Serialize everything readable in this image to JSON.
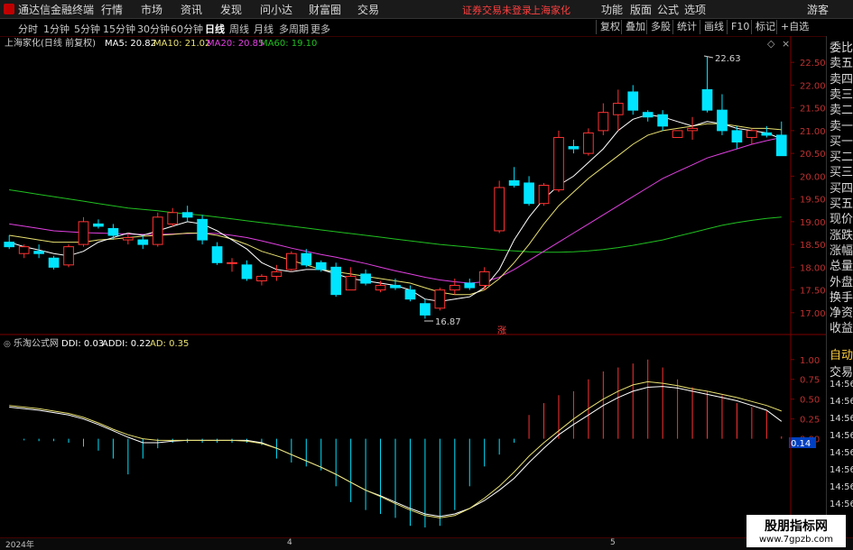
{
  "menubar": {
    "app_title": "通达信金融终端",
    "items": [
      "行情",
      "市场",
      "资讯",
      "发现",
      "问小达",
      "财富圈",
      "交易"
    ],
    "alert_text": "证券交易未登录",
    "alert_stock": "上海家化",
    "right_items": [
      "功能",
      "版面",
      "公式",
      "选项"
    ],
    "far_right": "游客"
  },
  "toolbar": {
    "periods": [
      "分时",
      "1分钟",
      "5分钟",
      "15分钟",
      "30分钟",
      "60分钟",
      "日线",
      "周线",
      "月线",
      "多周期",
      "更多"
    ],
    "selected": "日线",
    "right_buttons": [
      "复权",
      "叠加",
      "多股",
      "统计",
      "画线",
      "F10",
      "标记",
      "+自选"
    ]
  },
  "main_chart": {
    "header": "上海家化(日线 前复权)",
    "ma5_label": "MA5: 20.82",
    "ma10_label": "MA10: 21.02",
    "ma20_label": "MA20: 20.85",
    "ma60_label": "MA60: 19.10",
    "high_marker": "22.63",
    "low_marker": "16.87",
    "zhang_marker": "涨"
  },
  "indicator": {
    "header": "乐淘公式网",
    "ddi_label": "DDI: 0.03",
    "addi_label": "ADDI: 0.22",
    "ad_label": "AD: 0.35",
    "current_value": "0.14"
  },
  "colors": {
    "up": "#ff3232",
    "down": "#00e4ff",
    "ma5": "#ffffff",
    "ma10": "#e8e070",
    "ma20": "#e040e0",
    "ma60": "#20c020"
  },
  "right_panel": {
    "items": [
      "委比",
      "卖五",
      "卖四",
      "卖三",
      "卖二",
      "卖一",
      "买一",
      "买二",
      "买三",
      "买四",
      "买五",
      "现价",
      "涨跌",
      "涨幅",
      "总量",
      "外盘",
      "换手",
      "净资",
      "收益"
    ],
    "lower_items": [
      "自动",
      "交易",
      "14:56",
      "14:56",
      "14:56",
      "14:56",
      "14:56",
      "14:56",
      "14:56",
      "14:56"
    ]
  },
  "bottom": {
    "date_labels": [
      "2024年",
      "4",
      "5"
    ]
  },
  "watermark": {
    "line1": "股朋指标网",
    "line2": "www.7gpzb.com"
  },
  "chart_data": [
    {
      "type": "candlestick",
      "title": "上海家化(日线 前复权)",
      "ylim": [
        16.7,
        22.8
      ],
      "y_ticks": [
        17.0,
        17.5,
        18.0,
        18.5,
        19.0,
        19.5,
        20.0,
        20.5,
        21.0,
        21.5,
        22.0,
        22.5
      ],
      "candles": [
        {
          "o": 18.55,
          "h": 18.7,
          "l": 18.4,
          "c": 18.45
        },
        {
          "o": 18.3,
          "h": 18.5,
          "l": 18.2,
          "c": 18.45
        },
        {
          "o": 18.35,
          "h": 18.5,
          "l": 18.2,
          "c": 18.3
        },
        {
          "o": 18.2,
          "h": 18.25,
          "l": 17.95,
          "c": 18.0
        },
        {
          "o": 18.05,
          "h": 18.5,
          "l": 18.0,
          "c": 18.45
        },
        {
          "o": 18.5,
          "h": 19.1,
          "l": 18.45,
          "c": 19.0
        },
        {
          "o": 18.95,
          "h": 19.05,
          "l": 18.85,
          "c": 18.9
        },
        {
          "o": 18.85,
          "h": 18.95,
          "l": 18.6,
          "c": 18.7
        },
        {
          "o": 18.6,
          "h": 18.75,
          "l": 18.5,
          "c": 18.65
        },
        {
          "o": 18.6,
          "h": 18.7,
          "l": 18.4,
          "c": 18.5
        },
        {
          "o": 18.5,
          "h": 19.2,
          "l": 18.45,
          "c": 19.1
        },
        {
          "o": 18.95,
          "h": 19.3,
          "l": 18.9,
          "c": 19.2
        },
        {
          "o": 19.2,
          "h": 19.35,
          "l": 19.0,
          "c": 19.1
        },
        {
          "o": 19.05,
          "h": 19.15,
          "l": 18.5,
          "c": 18.6
        },
        {
          "o": 18.45,
          "h": 18.55,
          "l": 18.05,
          "c": 18.1
        },
        {
          "o": 18.1,
          "h": 18.2,
          "l": 17.9,
          "c": 18.1
        },
        {
          "o": 18.05,
          "h": 18.15,
          "l": 17.7,
          "c": 17.75
        },
        {
          "o": 17.7,
          "h": 17.85,
          "l": 17.6,
          "c": 17.8
        },
        {
          "o": 17.8,
          "h": 18.05,
          "l": 17.7,
          "c": 17.9
        },
        {
          "o": 17.95,
          "h": 18.35,
          "l": 17.9,
          "c": 18.3
        },
        {
          "o": 18.3,
          "h": 18.4,
          "l": 18.0,
          "c": 18.05
        },
        {
          "o": 18.1,
          "h": 18.15,
          "l": 17.9,
          "c": 17.95
        },
        {
          "o": 18.0,
          "h": 18.1,
          "l": 17.35,
          "c": 17.4
        },
        {
          "o": 17.5,
          "h": 18.0,
          "l": 17.5,
          "c": 17.8
        },
        {
          "o": 17.85,
          "h": 17.95,
          "l": 17.6,
          "c": 17.65
        },
        {
          "o": 17.5,
          "h": 17.7,
          "l": 17.45,
          "c": 17.6
        },
        {
          "o": 17.6,
          "h": 17.75,
          "l": 17.5,
          "c": 17.55
        },
        {
          "o": 17.5,
          "h": 17.6,
          "l": 17.25,
          "c": 17.3
        },
        {
          "o": 17.2,
          "h": 17.3,
          "l": 16.87,
          "c": 16.95
        },
        {
          "o": 17.1,
          "h": 17.55,
          "l": 17.05,
          "c": 17.5
        },
        {
          "o": 17.5,
          "h": 17.75,
          "l": 17.4,
          "c": 17.6
        },
        {
          "o": 17.65,
          "h": 17.75,
          "l": 17.5,
          "c": 17.55
        },
        {
          "o": 17.6,
          "h": 18.0,
          "l": 17.5,
          "c": 17.9
        },
        {
          "o": 18.8,
          "h": 19.9,
          "l": 18.75,
          "c": 19.75
        },
        {
          "o": 19.9,
          "h": 20.2,
          "l": 19.75,
          "c": 19.8
        },
        {
          "o": 19.85,
          "h": 20.0,
          "l": 19.35,
          "c": 19.4
        },
        {
          "o": 19.4,
          "h": 19.85,
          "l": 19.35,
          "c": 19.8
        },
        {
          "o": 19.7,
          "h": 21.0,
          "l": 19.65,
          "c": 20.85
        },
        {
          "o": 20.65,
          "h": 20.8,
          "l": 20.5,
          "c": 20.6
        },
        {
          "o": 20.5,
          "h": 21.05,
          "l": 20.45,
          "c": 20.95
        },
        {
          "o": 21.0,
          "h": 21.6,
          "l": 20.9,
          "c": 21.4
        },
        {
          "o": 21.35,
          "h": 21.9,
          "l": 21.0,
          "c": 21.6
        },
        {
          "o": 21.85,
          "h": 22.0,
          "l": 21.35,
          "c": 21.45
        },
        {
          "o": 21.4,
          "h": 21.45,
          "l": 21.2,
          "c": 21.3
        },
        {
          "o": 21.35,
          "h": 21.45,
          "l": 21.0,
          "c": 21.1
        },
        {
          "o": 20.85,
          "h": 21.0,
          "l": 20.85,
          "c": 21.0
        },
        {
          "o": 21.0,
          "h": 21.3,
          "l": 20.8,
          "c": 21.05
        },
        {
          "o": 21.9,
          "h": 22.63,
          "l": 21.4,
          "c": 21.45
        },
        {
          "o": 21.45,
          "h": 21.8,
          "l": 20.9,
          "c": 21.0
        },
        {
          "o": 21.0,
          "h": 21.1,
          "l": 20.6,
          "c": 20.75
        },
        {
          "o": 20.85,
          "h": 21.05,
          "l": 20.7,
          "c": 21.0
        },
        {
          "o": 20.95,
          "h": 21.1,
          "l": 20.85,
          "c": 20.9
        },
        {
          "o": 20.9,
          "h": 21.2,
          "l": 20.45,
          "c": 20.45
        }
      ],
      "ma5": [
        18.55,
        18.45,
        18.38,
        18.3,
        18.25,
        18.35,
        18.55,
        18.65,
        18.75,
        18.7,
        18.8,
        18.9,
        19.0,
        18.95,
        18.8,
        18.6,
        18.4,
        18.1,
        17.95,
        17.9,
        17.95,
        17.95,
        17.85,
        17.75,
        17.7,
        17.65,
        17.6,
        17.5,
        17.3,
        17.25,
        17.3,
        17.35,
        17.55,
        17.95,
        18.6,
        19.1,
        19.5,
        19.8,
        20.0,
        20.3,
        20.6,
        21.0,
        21.25,
        21.35,
        21.3,
        21.2,
        21.1,
        21.2,
        21.15,
        21.05,
        21.0,
        20.95,
        20.82
      ],
      "ma10": [
        18.7,
        18.65,
        18.6,
        18.55,
        18.55,
        18.55,
        18.6,
        18.62,
        18.65,
        18.68,
        18.7,
        18.72,
        18.75,
        18.75,
        18.7,
        18.62,
        18.5,
        18.35,
        18.25,
        18.15,
        18.05,
        17.95,
        17.9,
        17.85,
        17.8,
        17.75,
        17.7,
        17.65,
        17.55,
        17.45,
        17.4,
        17.4,
        17.5,
        17.75,
        18.1,
        18.5,
        18.95,
        19.35,
        19.65,
        19.95,
        20.2,
        20.45,
        20.7,
        20.9,
        21.0,
        21.05,
        21.1,
        21.15,
        21.15,
        21.1,
        21.05,
        21.05,
        21.02
      ],
      "ma20": [
        18.95,
        18.9,
        18.85,
        18.8,
        18.78,
        18.76,
        18.75,
        18.74,
        18.73,
        18.72,
        18.72,
        18.73,
        18.74,
        18.75,
        18.74,
        18.7,
        18.65,
        18.58,
        18.5,
        18.42,
        18.35,
        18.28,
        18.22,
        18.15,
        18.08,
        18.0,
        17.92,
        17.85,
        17.78,
        17.72,
        17.68,
        17.65,
        17.68,
        17.78,
        17.95,
        18.15,
        18.35,
        18.55,
        18.75,
        18.95,
        19.15,
        19.35,
        19.55,
        19.75,
        19.95,
        20.1,
        20.25,
        20.4,
        20.5,
        20.6,
        20.7,
        20.78,
        20.85
      ],
      "ma60": [
        19.7,
        19.65,
        19.6,
        19.55,
        19.5,
        19.45,
        19.4,
        19.35,
        19.3,
        19.27,
        19.24,
        19.2,
        19.17,
        19.14,
        19.1,
        19.06,
        19.02,
        18.98,
        18.94,
        18.9,
        18.86,
        18.82,
        18.78,
        18.74,
        18.7,
        18.66,
        18.62,
        18.58,
        18.54,
        18.5,
        18.47,
        18.44,
        18.41,
        18.38,
        18.36,
        18.34,
        18.33,
        18.33,
        18.34,
        18.36,
        18.39,
        18.43,
        18.48,
        18.54,
        18.6,
        18.68,
        18.76,
        18.84,
        18.92,
        18.98,
        19.03,
        19.07,
        19.1
      ]
    },
    {
      "type": "bar",
      "title": "乐淘公式网",
      "ylim": [
        -1.2,
        1.1
      ],
      "y_ticks": [
        0.0,
        0.25,
        0.5,
        0.75,
        1.0
      ],
      "series": [
        {
          "name": "DDI",
          "values": [
            0.0,
            -0.02,
            -0.03,
            -0.03,
            -0.05,
            -0.1,
            -0.15,
            -0.25,
            -0.45,
            -0.25,
            -0.12,
            -0.05,
            -0.05,
            -0.05,
            -0.05,
            -0.05,
            -0.05,
            -0.08,
            -0.25,
            -0.3,
            -0.35,
            -0.4,
            -0.6,
            -0.8,
            -0.9,
            -0.95,
            -1.0,
            -1.1,
            -1.12,
            -1.1,
            -0.9,
            -0.6,
            -0.35,
            -0.2,
            -0.05,
            0.3,
            0.45,
            0.55,
            0.6,
            0.75,
            0.85,
            0.9,
            0.95,
            1.0,
            0.9,
            0.75,
            0.65,
            0.6,
            0.55,
            0.45,
            0.4,
            0.35,
            0.03
          ]
        },
        {
          "name": "ADDI",
          "values": [
            0.4,
            0.38,
            0.36,
            0.33,
            0.3,
            0.25,
            0.18,
            0.1,
            0.02,
            -0.05,
            -0.05,
            -0.03,
            -0.02,
            -0.02,
            -0.02,
            -0.02,
            -0.02,
            -0.05,
            -0.12,
            -0.2,
            -0.28,
            -0.36,
            -0.45,
            -0.55,
            -0.65,
            -0.72,
            -0.8,
            -0.88,
            -0.95,
            -0.98,
            -0.95,
            -0.88,
            -0.78,
            -0.65,
            -0.5,
            -0.3,
            -0.12,
            0.05,
            0.18,
            0.3,
            0.42,
            0.52,
            0.6,
            0.65,
            0.66,
            0.64,
            0.6,
            0.56,
            0.52,
            0.48,
            0.42,
            0.36,
            0.22
          ]
        },
        {
          "name": "AD",
          "values": [
            0.42,
            0.4,
            0.38,
            0.35,
            0.32,
            0.27,
            0.2,
            0.12,
            0.05,
            0.0,
            -0.02,
            -0.02,
            -0.02,
            -0.02,
            -0.02,
            -0.02,
            -0.03,
            -0.06,
            -0.12,
            -0.2,
            -0.28,
            -0.36,
            -0.45,
            -0.55,
            -0.65,
            -0.73,
            -0.82,
            -0.9,
            -0.97,
            -1.0,
            -0.97,
            -0.88,
            -0.75,
            -0.6,
            -0.42,
            -0.22,
            -0.05,
            0.1,
            0.25,
            0.38,
            0.5,
            0.6,
            0.68,
            0.72,
            0.7,
            0.67,
            0.63,
            0.6,
            0.56,
            0.52,
            0.47,
            0.42,
            0.35
          ]
        }
      ]
    }
  ]
}
